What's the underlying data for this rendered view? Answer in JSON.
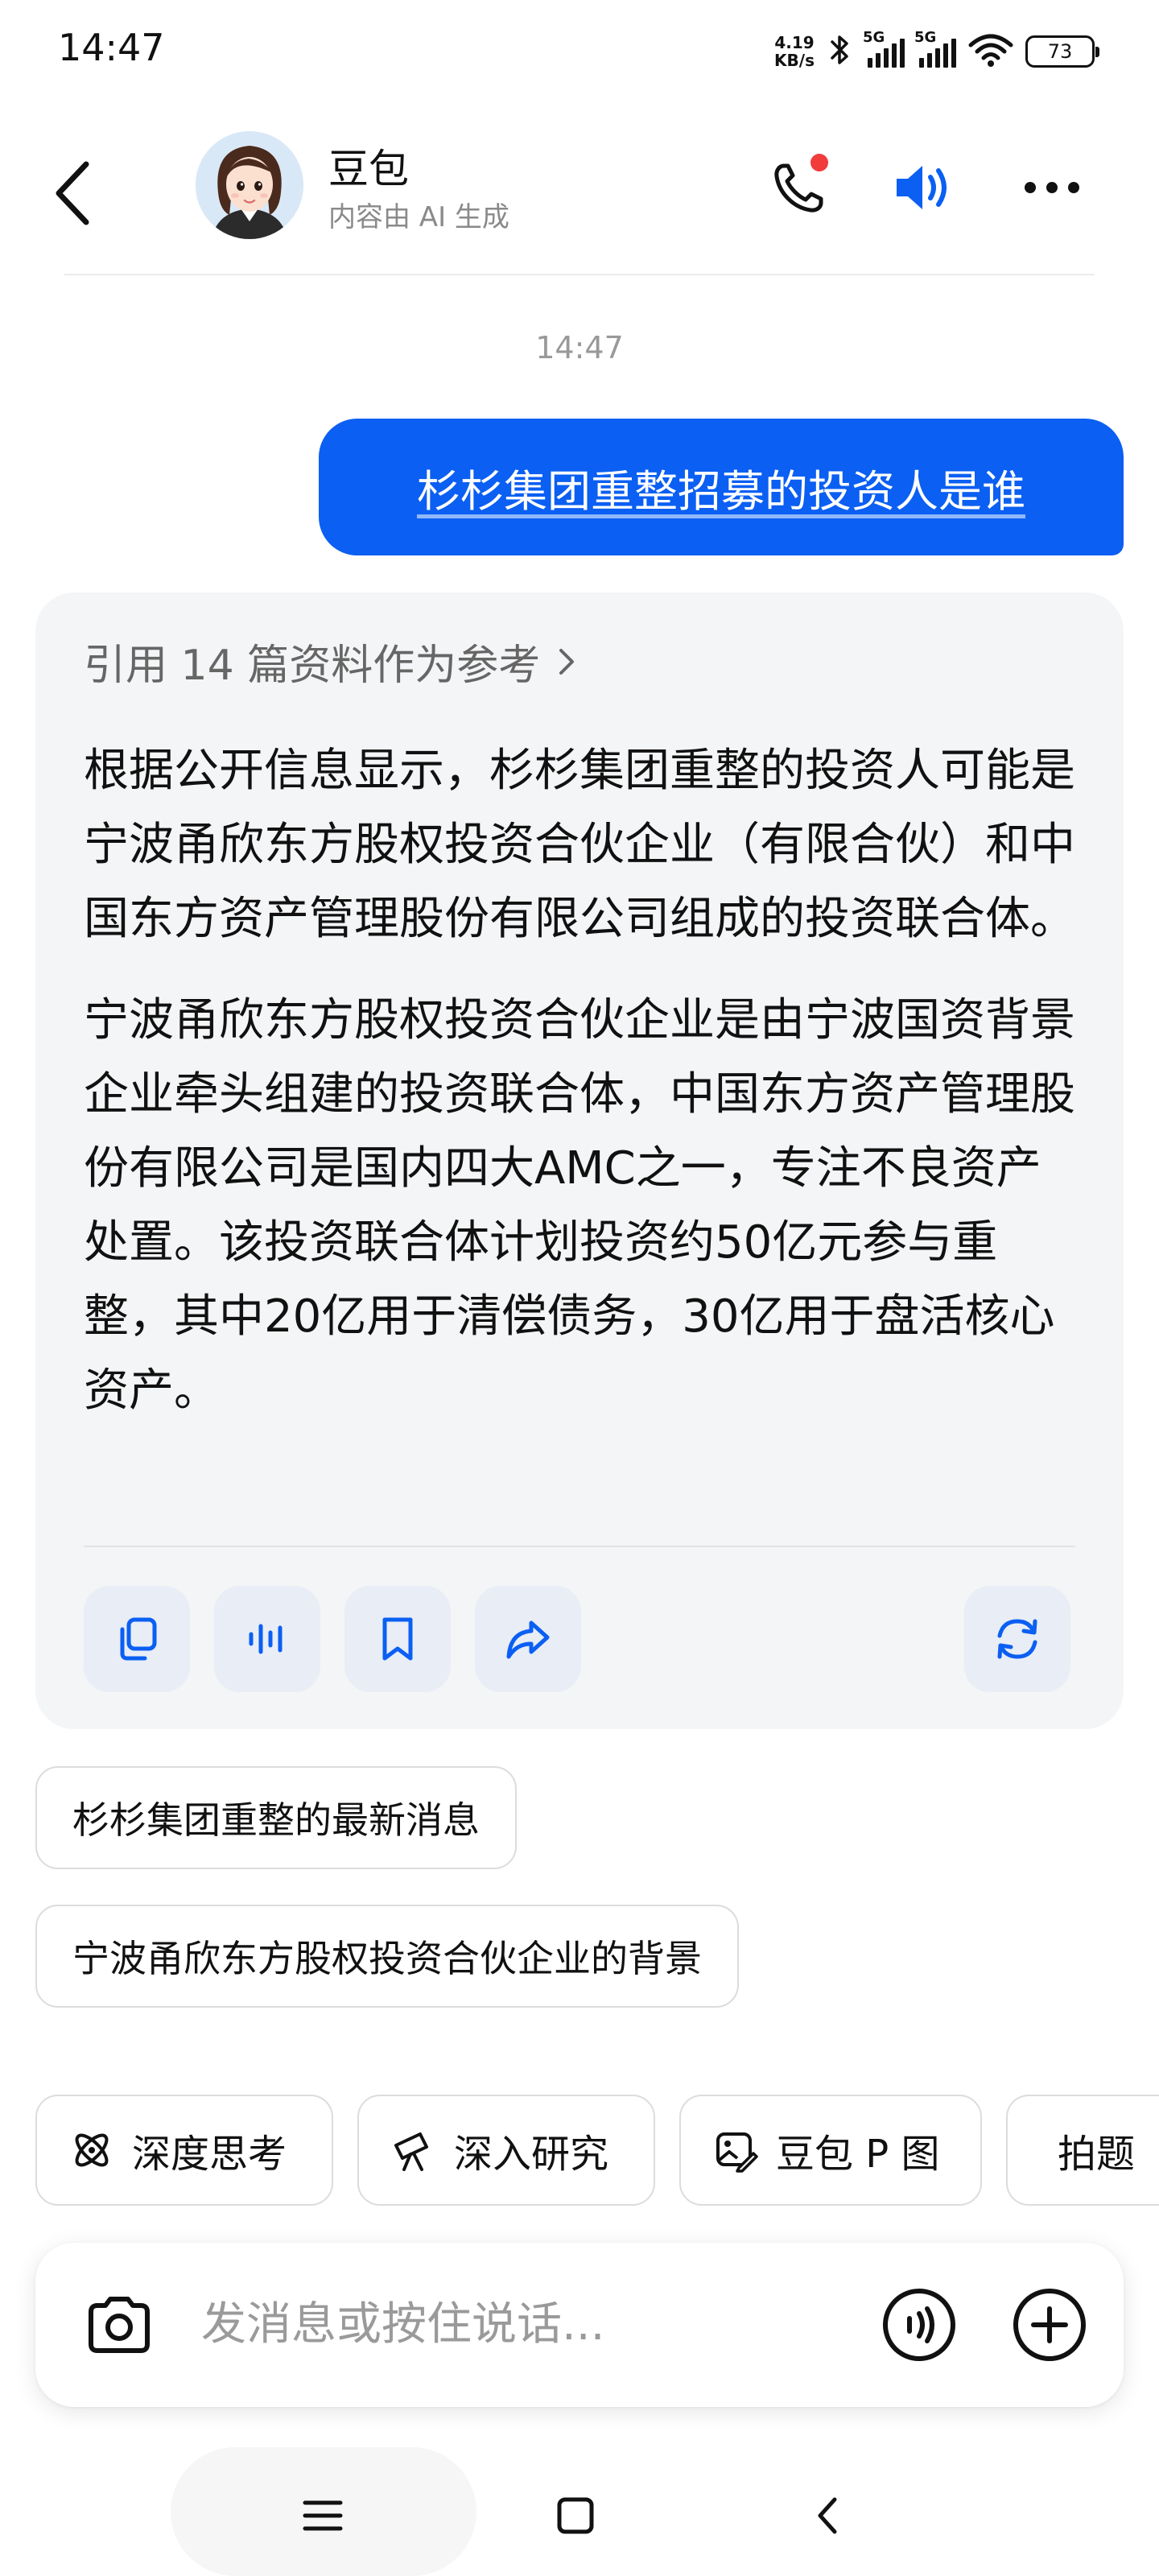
{
  "status_bar": {
    "time": "14:47",
    "net_speed_value": "4.19",
    "net_speed_unit": "KB/s",
    "sim1_label": "5G",
    "sim2_label": "5G",
    "battery": "73"
  },
  "header": {
    "bot_name": "豆包",
    "subtitle": "内容由 AI 生成"
  },
  "conversation": {
    "timestamp": "14:47",
    "user_message": "杉杉集团重整招募的投资人是谁",
    "references_label": "引用 14 篇资料作为参考",
    "answer_paragraphs": [
      "根据公开信息显示，杉杉集团重整的投资人可能是宁波甬欣东方股权投资合伙企业（有限合伙）和中国东方资产管理股份有限公司组成的投资联合体。",
      "宁波甬欣东方股权投资合伙企业是由宁波国资背景企业牵头组建的投资联合体，中国东方资产管理股份有限公司是国内四大AMC之一，专注不良资产处置。该投资联合体计划投资约50亿元参与重整，其中20亿用于清偿债务，30亿用于盘活核心资产。"
    ]
  },
  "suggestions": [
    "杉杉集团重整的最新消息",
    "宁波甬欣东方股权投资合伙企业的背景"
  ],
  "features": [
    {
      "label": "深度思考",
      "icon": "atom-icon"
    },
    {
      "label": "深入研究",
      "icon": "telescope-icon"
    },
    {
      "label": "豆包 P 图",
      "icon": "image-edit-icon"
    },
    {
      "label": "拍题",
      "icon": "scan-doc-icon"
    }
  ],
  "input": {
    "placeholder": "发消息或按住说话..."
  },
  "colors": {
    "accent": "#0b5ff2",
    "card_bg": "#f4f5f6",
    "notification_dot": "#f23b3b"
  }
}
